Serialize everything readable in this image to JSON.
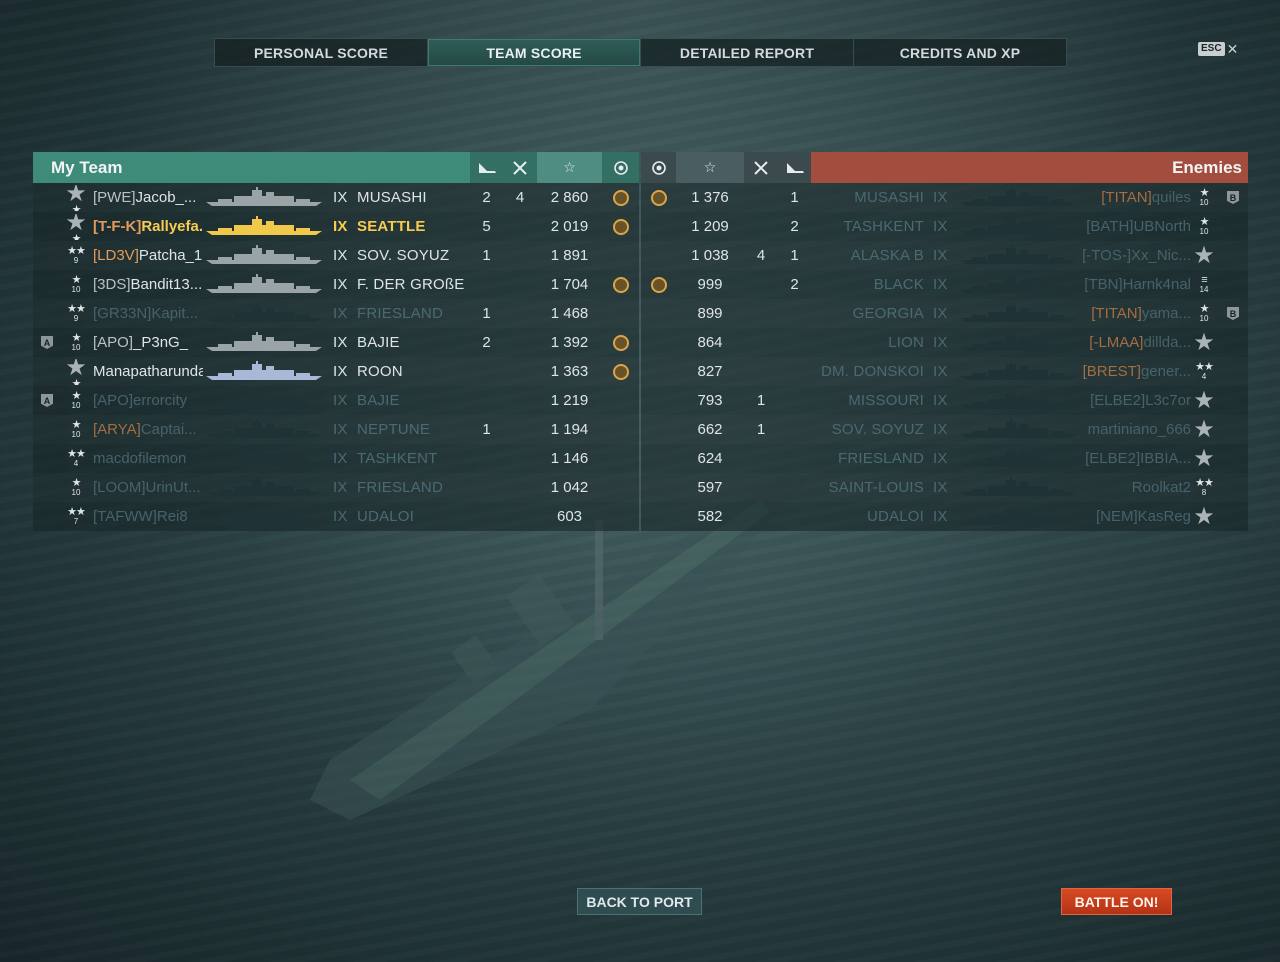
{
  "tabs": [
    {
      "label": "PERSONAL SCORE",
      "active": false
    },
    {
      "label": "TEAM SCORE",
      "active": true
    },
    {
      "label": "DETAILED REPORT",
      "active": false
    },
    {
      "label": "CREDITS AND XP",
      "active": false
    }
  ],
  "esc": {
    "key": "ESC",
    "close": "✕"
  },
  "my_team": {
    "title": "My Team",
    "columns": [
      "ships-destroyed-icon",
      "planes-destroyed-icon",
      "base-xp-star-icon",
      "achievements-icon"
    ],
    "players": [
      {
        "division": "",
        "rank_stars": "★",
        "rank_level": "",
        "rank_big": "★",
        "clan": "[PWE]",
        "clan_orange": false,
        "name": "Jacob_...",
        "tier": "IX",
        "ship": "MUSASHI",
        "kills": "2",
        "planes": "4",
        "score": "2 860",
        "medal": true,
        "alive": true,
        "me": false,
        "silh_color": "#9aa3a6"
      },
      {
        "division": "",
        "rank_stars": "★",
        "rank_level": "",
        "rank_big": "★",
        "clan": "[T-F-K]",
        "clan_orange": true,
        "name": "Rallyefa...",
        "tier": "IX",
        "ship": "SEATTLE",
        "kills": "5",
        "planes": "",
        "score": "2 019",
        "medal": true,
        "alive": true,
        "me": true,
        "silh_color": "#f1c94a"
      },
      {
        "division": "",
        "rank_stars": "★★",
        "rank_level": "9",
        "rank_big": "",
        "clan": "[LD3V]",
        "clan_orange": true,
        "name": "Patcha_1",
        "tier": "IX",
        "ship": "SOV. SOYUZ",
        "kills": "1",
        "planes": "",
        "score": "1 891",
        "medal": false,
        "alive": true,
        "me": false,
        "silh_color": "#9aa3a6"
      },
      {
        "division": "",
        "rank_stars": "★",
        "rank_level": "10",
        "rank_big": "",
        "clan": "[3DS]",
        "clan_orange": false,
        "name": "Bandit13...",
        "tier": "IX",
        "ship": "F. DER GROßE",
        "kills": "",
        "planes": "",
        "score": "1 704",
        "medal": true,
        "alive": true,
        "me": false,
        "silh_color": "#9aa3a6"
      },
      {
        "division": "",
        "rank_stars": "★★",
        "rank_level": "9",
        "rank_big": "",
        "clan": "[GR33N]",
        "clan_orange": false,
        "name": "Kapit...",
        "tier": "IX",
        "ship": "FRIESLAND",
        "kills": "1",
        "planes": "",
        "score": "1 468",
        "medal": false,
        "alive": false,
        "me": false,
        "silh_color": "#1f3236"
      },
      {
        "division": "A",
        "rank_stars": "★",
        "rank_level": "10",
        "rank_big": "",
        "clan": "[APO]",
        "clan_orange": false,
        "name": "_P3nG_",
        "tier": "IX",
        "ship": "BAJIE",
        "kills": "2",
        "planes": "",
        "score": "1 392",
        "medal": true,
        "alive": true,
        "me": false,
        "silh_color": "#9aa3a6"
      },
      {
        "division": "",
        "rank_stars": "★",
        "rank_level": "",
        "rank_big": "★",
        "clan": "",
        "clan_orange": false,
        "name": "Manapatharunda",
        "tier": "IX",
        "ship": "ROON",
        "kills": "",
        "planes": "",
        "score": "1 363",
        "medal": true,
        "alive": true,
        "me": false,
        "silh_color": "#aab8d8"
      },
      {
        "division": "A",
        "rank_stars": "★",
        "rank_level": "10",
        "rank_big": "",
        "clan": "[APO]",
        "clan_orange": false,
        "name": "errorcity",
        "tier": "IX",
        "ship": "BAJIE",
        "kills": "",
        "planes": "",
        "score": "1 219",
        "medal": false,
        "alive": false,
        "me": false,
        "silh_color": "#1f3236"
      },
      {
        "division": "",
        "rank_stars": "★",
        "rank_level": "10",
        "rank_big": "",
        "clan": "[ARYA]",
        "clan_orange": true,
        "name": "Captai...",
        "tier": "IX",
        "ship": "NEPTUNE",
        "kills": "1",
        "planes": "",
        "score": "1 194",
        "medal": false,
        "alive": false,
        "me": false,
        "silh_color": "#1f3236"
      },
      {
        "division": "",
        "rank_stars": "★★",
        "rank_level": "4",
        "rank_big": "",
        "clan": "",
        "clan_orange": false,
        "name": "macdofilemon",
        "tier": "IX",
        "ship": "TASHKENT",
        "kills": "",
        "planes": "",
        "score": "1 146",
        "medal": false,
        "alive": false,
        "me": false,
        "silh_color": "#1f3236"
      },
      {
        "division": "",
        "rank_stars": "★",
        "rank_level": "10",
        "rank_big": "",
        "clan": "[LOOM]",
        "clan_orange": false,
        "name": "UrinUt...",
        "tier": "IX",
        "ship": "FRIESLAND",
        "kills": "",
        "planes": "",
        "score": "1 042",
        "medal": false,
        "alive": false,
        "me": false,
        "silh_color": "#1f3236"
      },
      {
        "division": "",
        "rank_stars": "★★",
        "rank_level": "7",
        "rank_big": "",
        "clan": "[TAFWW]",
        "clan_orange": false,
        "name": "Rei8",
        "tier": "IX",
        "ship": "UDALOI",
        "kills": "",
        "planes": "",
        "score": "603",
        "medal": false,
        "alive": false,
        "me": false,
        "silh_color": "#1f3236"
      }
    ]
  },
  "enemies": {
    "title": "Enemies",
    "columns": [
      "achievements-icon",
      "base-xp-star-icon",
      "planes-destroyed-icon",
      "ships-destroyed-icon"
    ],
    "players": [
      {
        "medal": true,
        "score": "1 376",
        "planes": "",
        "kills": "1",
        "ship": "MUSASHI",
        "tier": "IX",
        "clan": "[TITAN]",
        "clan_orange": true,
        "name": "quiles",
        "rank_stars": "★",
        "rank_level": "10",
        "rank_big": "",
        "division": "B",
        "alive": false,
        "silh_color": "#1f3236"
      },
      {
        "medal": false,
        "score": "1 209",
        "planes": "",
        "kills": "2",
        "ship": "TASHKENT",
        "tier": "IX",
        "clan": "[BATH]",
        "clan_orange": false,
        "name": "UBNorth",
        "rank_stars": "★",
        "rank_level": "10",
        "rank_big": "",
        "division": "",
        "alive": false,
        "silh_color": "#1f3236"
      },
      {
        "medal": false,
        "score": "1 038",
        "planes": "4",
        "kills": "1",
        "ship": "ALASKA B",
        "tier": "IX",
        "clan": "[-TOS-]",
        "clan_orange": false,
        "name": "Xx_Nic...",
        "rank_stars": "",
        "rank_level": "",
        "rank_big": "★",
        "division": "",
        "alive": false,
        "silh_color": "#1f3236"
      },
      {
        "medal": true,
        "score": "999",
        "planes": "",
        "kills": "2",
        "ship": "BLACK",
        "tier": "IX",
        "clan": "[TBN]",
        "clan_orange": false,
        "name": "Harnk4nal",
        "rank_stars": "≡",
        "rank_level": "14",
        "rank_big": "",
        "division": "",
        "alive": false,
        "silh_color": "#1f3236"
      },
      {
        "medal": false,
        "score": "899",
        "planes": "",
        "kills": "",
        "ship": "GEORGIA",
        "tier": "IX",
        "clan": "[TITAN]",
        "clan_orange": true,
        "name": "yama...",
        "rank_stars": "★",
        "rank_level": "10",
        "rank_big": "",
        "division": "B",
        "alive": false,
        "silh_color": "#1f3236"
      },
      {
        "medal": false,
        "score": "864",
        "planes": "",
        "kills": "",
        "ship": "LION",
        "tier": "IX",
        "clan": "[-LMAA]",
        "clan_orange": true,
        "name": "dillda...",
        "rank_stars": "",
        "rank_level": "",
        "rank_big": "★",
        "division": "",
        "alive": false,
        "silh_color": "#1f3236"
      },
      {
        "medal": false,
        "score": "827",
        "planes": "",
        "kills": "",
        "ship": "DM. DONSKOI",
        "tier": "IX",
        "clan": "[BREST]",
        "clan_orange": true,
        "name": "gener...",
        "rank_stars": "★★",
        "rank_level": "4",
        "rank_big": "",
        "division": "",
        "alive": false,
        "silh_color": "#1f3236"
      },
      {
        "medal": false,
        "score": "793",
        "planes": "1",
        "kills": "",
        "ship": "MISSOURI",
        "tier": "IX",
        "clan": "[ELBE2]",
        "clan_orange": false,
        "name": "L3c7or",
        "rank_stars": "",
        "rank_level": "",
        "rank_big": "★",
        "division": "",
        "alive": false,
        "silh_color": "#1f3236"
      },
      {
        "medal": false,
        "score": "662",
        "planes": "1",
        "kills": "",
        "ship": "SOV. SOYUZ",
        "tier": "IX",
        "clan": "",
        "clan_orange": false,
        "name": "martiniano_666",
        "rank_stars": "",
        "rank_level": "",
        "rank_big": "★",
        "division": "",
        "alive": false,
        "silh_color": "#1f3236"
      },
      {
        "medal": false,
        "score": "624",
        "planes": "",
        "kills": "",
        "ship": "FRIESLAND",
        "tier": "IX",
        "clan": "[ELBE2]",
        "clan_orange": false,
        "name": "IBBIA...",
        "rank_stars": "",
        "rank_level": "",
        "rank_big": "★",
        "division": "",
        "alive": false,
        "silh_color": "#1f3236"
      },
      {
        "medal": false,
        "score": "597",
        "planes": "",
        "kills": "",
        "ship": "SAINT-LOUIS",
        "tier": "IX",
        "clan": "",
        "clan_orange": false,
        "name": "Roolkat2",
        "rank_stars": "★★",
        "rank_level": "8",
        "rank_big": "",
        "division": "",
        "alive": false,
        "silh_color": "#1f3236"
      },
      {
        "medal": false,
        "score": "582",
        "planes": "",
        "kills": "",
        "ship": "UDALOI",
        "tier": "IX",
        "clan": "[NEM]",
        "clan_orange": false,
        "name": "KasReg",
        "rank_stars": "",
        "rank_level": "",
        "rank_big": "★",
        "division": "",
        "alive": false,
        "silh_color": "#1f3236"
      }
    ]
  },
  "buttons": {
    "back": "BACK TO PORT",
    "battle": "BATTLE ON!"
  },
  "colors": {
    "my_team": "#3e8b7a",
    "enemies": "#a24d3e",
    "self": "#f6cc50",
    "clan_orange": "#e39b5b",
    "battle_button": "#c83e1c"
  }
}
